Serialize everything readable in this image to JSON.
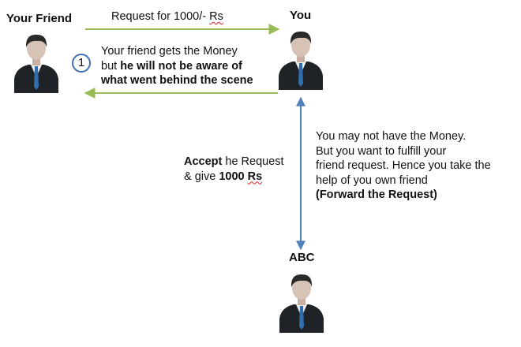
{
  "actors": {
    "friend": "Your Friend",
    "you": "You",
    "abc": "ABC"
  },
  "request_label": {
    "prefix": "Request for 1000/- ",
    "currency": "Rs"
  },
  "response": {
    "step_number": "1",
    "line1": "Your friend gets the Money",
    "line2_plain": "but ",
    "line2_bold": "he will not be aware of",
    "line3_bold": "what went behind the scene"
  },
  "accept": {
    "line1_bold": "Accept",
    "line1_plain": " he Request",
    "line2_plain": "& give ",
    "line2_bold": "1000 ",
    "line2_currency": "Rs"
  },
  "forward": {
    "line1": "You may not have the Money.",
    "line2": "But you want to fulfill your",
    "line3": "friend request. Hence you take the",
    "line4": "help of you own friend",
    "line5_bold": "(Forward the Request)"
  },
  "colors": {
    "horizontal_arrow": "#9bbb59",
    "vertical_arrow": "#4f81bd",
    "badge_border": "#3b6fb4",
    "suit": "#1f2328",
    "tie": "#2f6fb0",
    "skin": "#d7c2b6",
    "hair": "#2a2a2a"
  },
  "icons": [
    "person-icon",
    "person-icon",
    "person-icon"
  ]
}
